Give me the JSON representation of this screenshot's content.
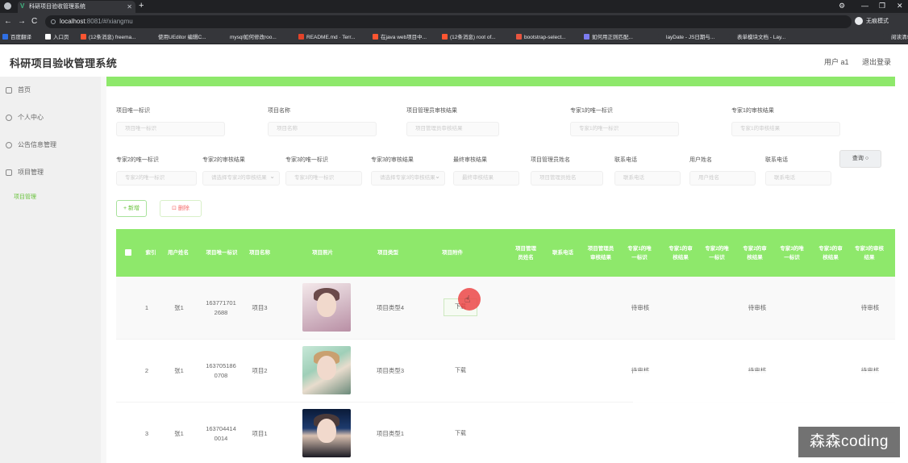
{
  "browser": {
    "tab_title": "科研项目验收管理系统",
    "url_host": "localhost",
    "url_path": ":8081/#/xiangmu",
    "profile_label": "无痕模式",
    "bookmarks": [
      {
        "label": "百度翻译",
        "color": "#2f6fe4"
      },
      {
        "label": "入口页",
        "color": "#ffffff"
      },
      {
        "label": "(12条消息) freema...",
        "color": "#fc5531"
      },
      {
        "label": "使用UEditor 编辑C...",
        "color": "#35363a"
      },
      {
        "label": "mysql如何修改roo...",
        "color": "#35363a"
      },
      {
        "label": "README.md · Terr...",
        "color": "#e24329"
      },
      {
        "label": "在java web项目中...",
        "color": "#fc5531"
      },
      {
        "label": "(12条消息) root of...",
        "color": "#fc5531"
      },
      {
        "label": "bootstrap-select...",
        "color": "#e8553f"
      },
      {
        "label": "如何用正则匹配...",
        "color": "#7c7cf0"
      },
      {
        "label": "layDate - JS日期与...",
        "color": "#35363a"
      },
      {
        "label": "表单模块文档 - Lay...",
        "color": "#35363a"
      },
      {
        "label": "阅读清单",
        "color": "#35363a"
      }
    ]
  },
  "header": {
    "title": "科研项目验收管理系统",
    "user": "用户 a1",
    "logout": "退出登录"
  },
  "sidebar": {
    "items": [
      {
        "label": "首页"
      },
      {
        "label": "个人中心"
      },
      {
        "label": "公告信息管理"
      },
      {
        "label": "项目管理"
      }
    ],
    "active_sub": "项目管理",
    "accent_color": "#67c23a"
  },
  "filters": {
    "row1": [
      {
        "label": "项目唯一标识",
        "placeholder": "项目唯一标识"
      },
      {
        "label": "项目名称",
        "placeholder": "项目名称"
      },
      {
        "label": "项目管理员审核结果",
        "placeholder": "项目管理员审核结果"
      },
      {
        "label": "专家1的唯一标识",
        "placeholder": "专家1的唯一标识"
      },
      {
        "label": "专家1的审核结果",
        "placeholder": "专家1的审核结果"
      }
    ],
    "row2": [
      {
        "label": "专家2的唯一标识",
        "placeholder": "专家2的唯一标识"
      },
      {
        "label": "专家2的审核结果",
        "placeholder": "请选择专家2的审核结果"
      },
      {
        "label": "专家3的唯一标识",
        "placeholder": "专家3的唯一标识"
      },
      {
        "label": "专家3的审核结果",
        "placeholder": "请选择专家3的审核结果"
      },
      {
        "label": "最终审核结果",
        "placeholder": "最终审核结果"
      },
      {
        "label": "项目管理员姓名",
        "placeholder": "项目管理员姓名"
      },
      {
        "label": "联系电话",
        "placeholder": "联系电话"
      },
      {
        "label": "用户姓名",
        "placeholder": "用户姓名"
      },
      {
        "label": "联系电话",
        "placeholder": "联系电话"
      }
    ],
    "query_button": "查询",
    "query_icon": "search-icon"
  },
  "actions": {
    "add": "+ 新增",
    "delete": "删除"
  },
  "table": {
    "header_color": "#8ee86b",
    "columns": [
      "索引",
      "用户姓名",
      "项目唯一标识",
      "项目名称",
      "项目照片",
      "项目类型",
      "项目附件",
      "项目管理员姓名",
      "联系电话",
      "项目管理员审核结果",
      "专家1的唯一标识",
      "专家1的审核结果",
      "专家2的唯一标识",
      "专家2的审核结果",
      "专家3的唯一标识",
      "专家3的审核结果",
      "专家3的审核结果"
    ],
    "rows": [
      {
        "index": "1",
        "user": "张1",
        "id": "1637717012688",
        "name": "项目3",
        "type": "项目类型4",
        "attachment": "下载",
        "admin_review": "待审核",
        "expert1_review": "待审核",
        "expert2_review": "待审核"
      },
      {
        "index": "2",
        "user": "张1",
        "id": "1637051860708",
        "name": "项目2",
        "type": "项目类型3",
        "attachment": "下载",
        "admin_review": "待审核",
        "expert1_review": "待审核",
        "expert2_review": "待审核"
      },
      {
        "index": "3",
        "user": "张1",
        "id": "1637044140014",
        "name": "项目1",
        "type": "项目类型1",
        "attachment": "下载",
        "admin_review": "",
        "expert1_review": "",
        "expert2_review": ""
      }
    ]
  },
  "watermark": "森森coding"
}
